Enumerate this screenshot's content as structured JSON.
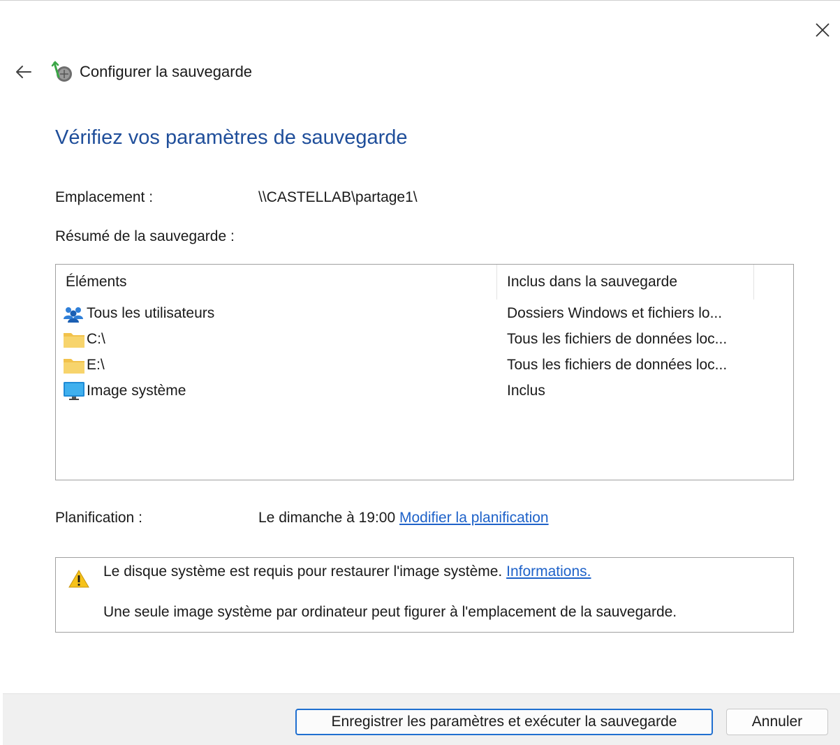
{
  "window": {
    "title": "Configurer la sauvegarde",
    "close_glyph": "✕",
    "back_glyph": "←",
    "app_icon": "backup-app-icon"
  },
  "page_title": "Vérifiez vos paramètres de sauvegarde",
  "location": {
    "label": "Emplacement :",
    "value": "\\\\CASTELLAB\\partage1\\"
  },
  "summary": {
    "label": "Résumé de la sauvegarde :",
    "columns": [
      "Éléments",
      "Inclus dans la sauvegarde"
    ],
    "rows": [
      {
        "icon": "users-icon",
        "name": "Tous les utilisateurs",
        "included": "Dossiers Windows et fichiers lo..."
      },
      {
        "icon": "folder-icon",
        "name": "C:\\",
        "included": "Tous les fichiers de données loc..."
      },
      {
        "icon": "folder-icon",
        "name": "E:\\",
        "included": "Tous les fichiers de données loc..."
      },
      {
        "icon": "monitor-icon",
        "name": "Image système",
        "included": "Inclus"
      }
    ]
  },
  "schedule": {
    "label": "Planification :",
    "value": "Le dimanche à 19:00",
    "link": "Modifier la planification"
  },
  "notice": {
    "icon": "warning-icon",
    "line1": "Le disque système est requis pour restaurer l'image système.",
    "line1_link": "Informations.",
    "line2": "Une seule image système par ordinateur peut figurer à l'emplacement de la sauvegarde."
  },
  "buttons": {
    "save_run": "Enregistrer les paramètres et exécuter la sauvegarde",
    "cancel": "Annuler"
  },
  "colors": {
    "title_blue": "#1f4e9a",
    "link_blue": "#1e62c9",
    "primary_border": "#1f6fd0",
    "footer_bg": "#f0f0f0"
  }
}
